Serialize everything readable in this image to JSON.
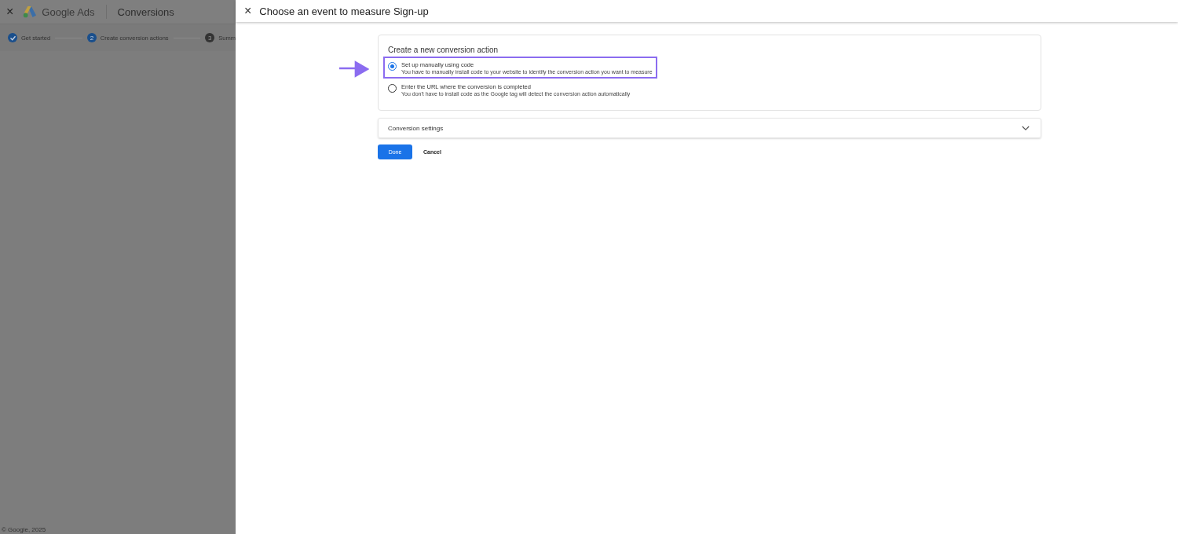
{
  "background_page": {
    "close_icon": "×",
    "product": "Google Ads",
    "page_title": "Conversions",
    "steps": [
      {
        "label": "Get started",
        "kind": "done"
      },
      {
        "marker": "2",
        "label": "Create conversion actions",
        "kind": "current"
      },
      {
        "marker": "3",
        "label": "Summ",
        "kind": "pending"
      }
    ],
    "footer": "© Google, 2025"
  },
  "panel": {
    "close_icon": "×",
    "title": "Choose an event to measure Sign-up",
    "card": {
      "heading": "Create a new conversion action",
      "options": [
        {
          "label": "Set up manually using code",
          "description": "You have to manually install code to your website to identify the conversion action you want to measure",
          "selected": true,
          "highlighted": true
        },
        {
          "label": "Enter the URL where the conversion is completed",
          "description": "You don't have to install code as the Google tag will detect the conversion action automatically",
          "selected": false,
          "highlighted": false
        }
      ]
    },
    "settings": {
      "label": "Conversion settings",
      "expanded": false
    },
    "buttons": [
      {
        "label": "Done",
        "kind": "primary"
      },
      {
        "label": "Cancel",
        "kind": "text"
      }
    ]
  }
}
